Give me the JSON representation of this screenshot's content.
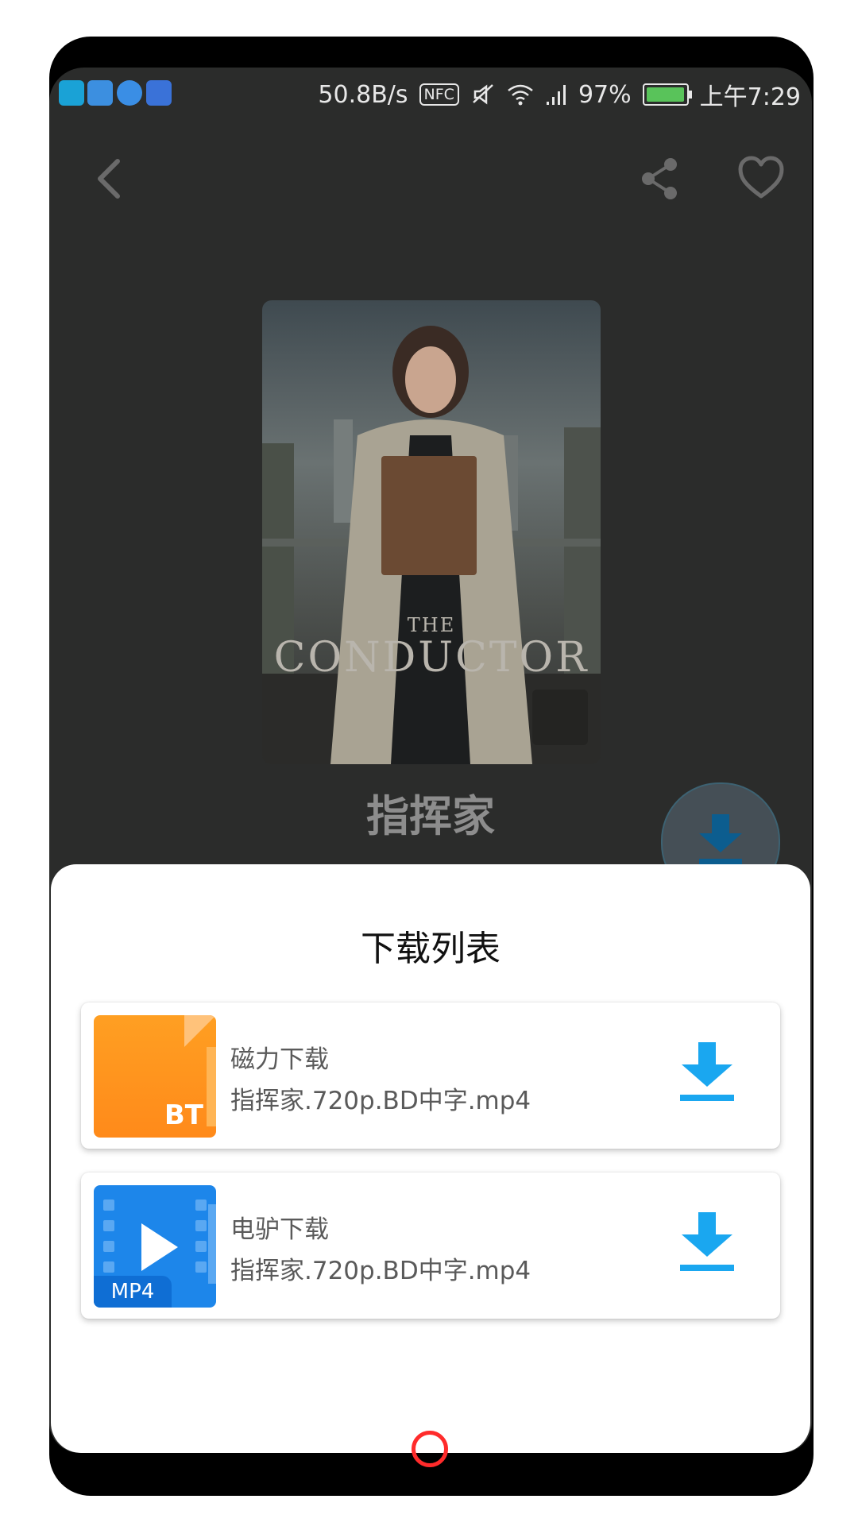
{
  "status_bar": {
    "speed": "50.8B/s",
    "nfc_label": "NFC",
    "battery_percent": "97%",
    "time": "上午7:29",
    "battery_level": 0.97
  },
  "movie": {
    "poster_small_text": "THE",
    "poster_text": "CONDUCTOR",
    "title": "指挥家"
  },
  "download_sheet": {
    "title": "下载列表",
    "items": [
      {
        "icon_label": "BT",
        "type_label": "磁力下载",
        "filename": "指挥家.720p.BD中字.mp4"
      },
      {
        "icon_label": "MP4",
        "type_label": "电驴下载",
        "filename": "指挥家.720p.BD中字.mp4"
      }
    ]
  },
  "colors": {
    "accent_blue": "#1aa7f0",
    "bt_orange": "#ff9a1f",
    "mp4_blue": "#1d86ea",
    "home_ring": "#ff2b2b"
  },
  "icons": [
    "back-arrow-icon",
    "share-icon",
    "heart-icon",
    "download-icon"
  ]
}
